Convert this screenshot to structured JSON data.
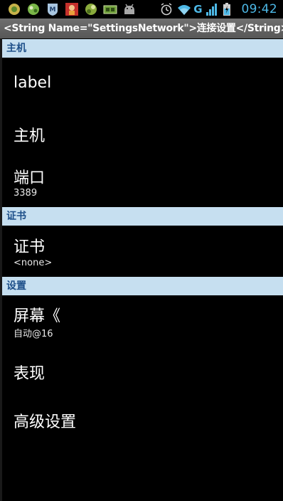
{
  "status_bar": {
    "time": "09:42",
    "network_type": "G",
    "notification_icons": [
      "app-icon-1",
      "app-icon-2",
      "malwarebytes-icon",
      "app-icon-red",
      "app-icon-3",
      "usb-debug-icon",
      "android-icon"
    ],
    "system_icons": [
      "alarm-icon",
      "wifi-icon",
      "signal-icon",
      "battery-icon"
    ]
  },
  "title_bar": {
    "title": "<String Name=\"SettingsNetwork\">连接设置</String>"
  },
  "sections": {
    "host": {
      "header": "主机",
      "label_item": "label",
      "host_item": "主机",
      "port_title": "端口",
      "port_value": "3389"
    },
    "certificate": {
      "header": "证书",
      "cert_title": "证书",
      "cert_value": "<none>"
    },
    "settings": {
      "header": "设置",
      "screen_title": "屏幕《",
      "screen_value": "自动@16",
      "performance_title": "表现",
      "advanced_title": "高级设置"
    }
  },
  "colors": {
    "section_header_bg": "#c6dff0",
    "section_header_text": "#1d4f89",
    "clock": "#4db8e6",
    "background": "#000000"
  }
}
